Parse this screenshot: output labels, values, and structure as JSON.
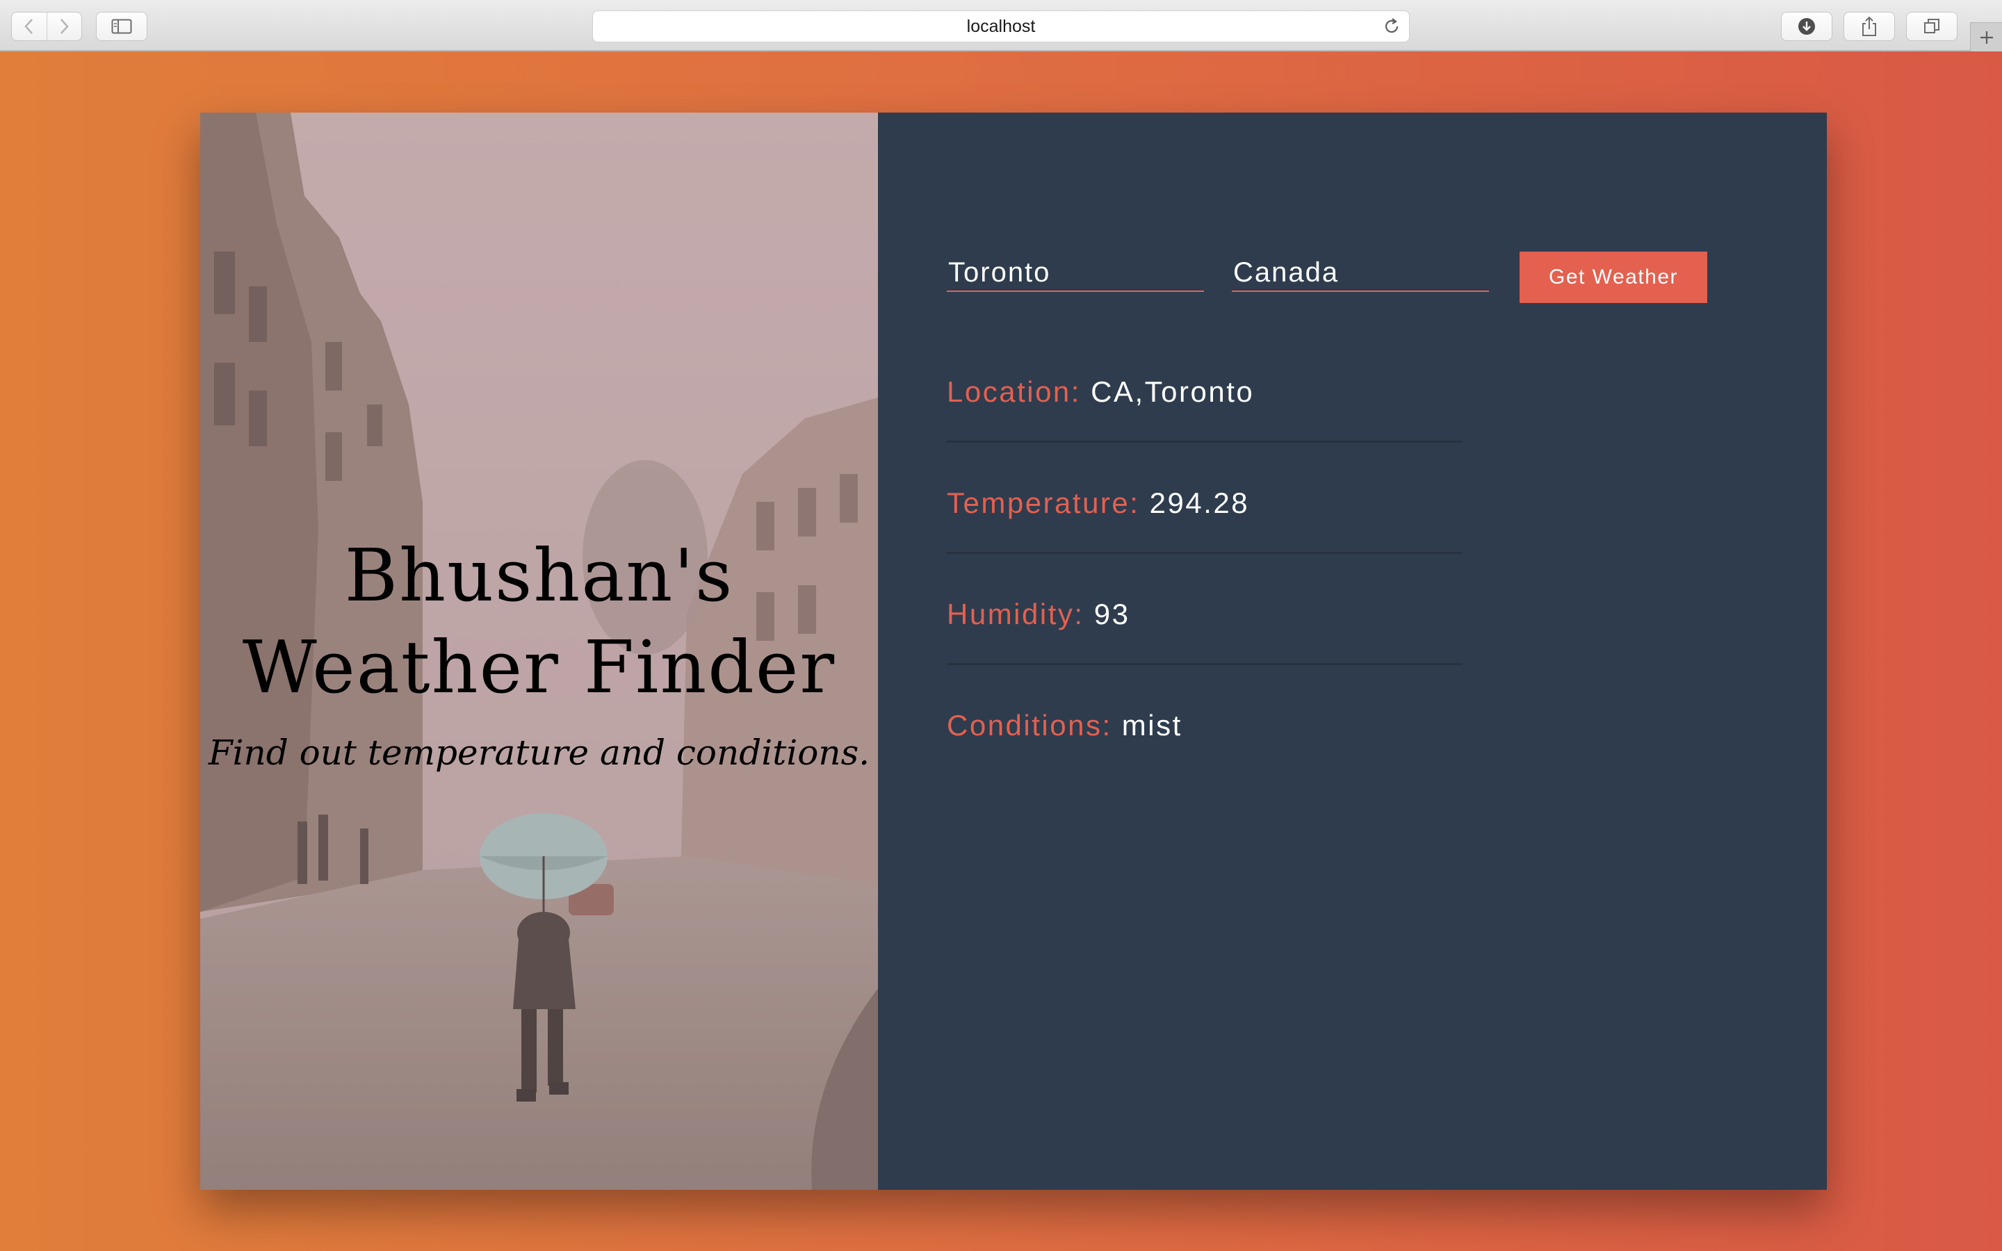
{
  "browser": {
    "address": "localhost",
    "icons": {
      "back": "chevron-left-icon",
      "forward": "chevron-right-icon",
      "sidebar": "sidebar-icon",
      "reload": "reload-icon",
      "downloads": "download-icon",
      "share": "share-icon",
      "tabs": "tabs-icon",
      "new_tab": "plus-icon"
    }
  },
  "hero": {
    "title_line1": "Bhushan's",
    "title_line2": "Weather Finder",
    "subtitle": "Find out temperature and conditions."
  },
  "form": {
    "city_value": "Toronto",
    "country_value": "Canada",
    "submit_label": "Get Weather"
  },
  "results": [
    {
      "label": "Location:",
      "value": "CA,Toronto"
    },
    {
      "label": "Temperature:",
      "value": "294.28"
    },
    {
      "label": "Humidity:",
      "value": "93"
    },
    {
      "label": "Conditions:",
      "value": "mist"
    }
  ],
  "colors": {
    "accent": "#e4604f",
    "panel_bg": "#2e3c4e",
    "page_gradient_start": "#e07e3a",
    "page_gradient_end": "#d95945"
  }
}
